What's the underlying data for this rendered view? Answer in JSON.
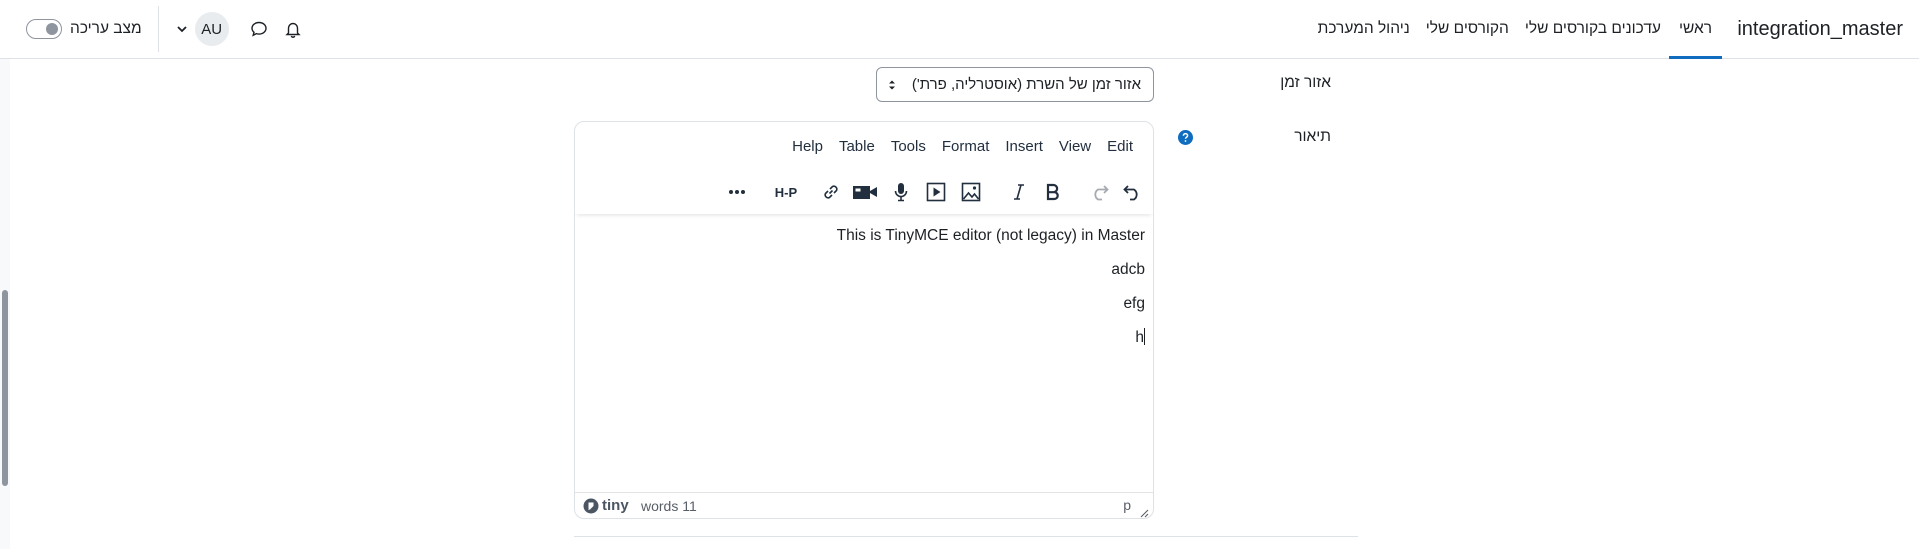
{
  "navbar": {
    "brand": "integration_master",
    "links": [
      {
        "label": "ראשי",
        "active": true
      },
      {
        "label": "עדכונים בקורסים שלי",
        "active": false
      },
      {
        "label": "הקורסים שלי",
        "active": false
      },
      {
        "label": "ניהול המערכת",
        "active": false
      }
    ],
    "edit_mode_label": "מצב עריכה",
    "avatar_initials": "AU",
    "accent_color": "#0f6cbf"
  },
  "form": {
    "timezone": {
      "label": "אזור זמן",
      "selected": "אזור זמן של השרת (אוסטרליה, פרת')"
    },
    "description": {
      "label": "תיאור"
    }
  },
  "editor": {
    "menu": [
      "Edit",
      "View",
      "Insert",
      "Format",
      "Tools",
      "Table",
      "Help"
    ],
    "toolbar_icons": [
      "undo-icon",
      "redo-icon",
      "bold-icon",
      "italic-icon",
      "image-icon",
      "media-icon",
      "microphone-icon",
      "camera-icon",
      "link-icon",
      "h5p-icon",
      "more-icon"
    ],
    "h5p_label": "H-P",
    "content": [
      "This is TinyMCE editor (not legacy) in Master",
      "adcb",
      "efg",
      "h"
    ],
    "logo_text": "tiny",
    "word_count": "words 11",
    "path": "p"
  }
}
